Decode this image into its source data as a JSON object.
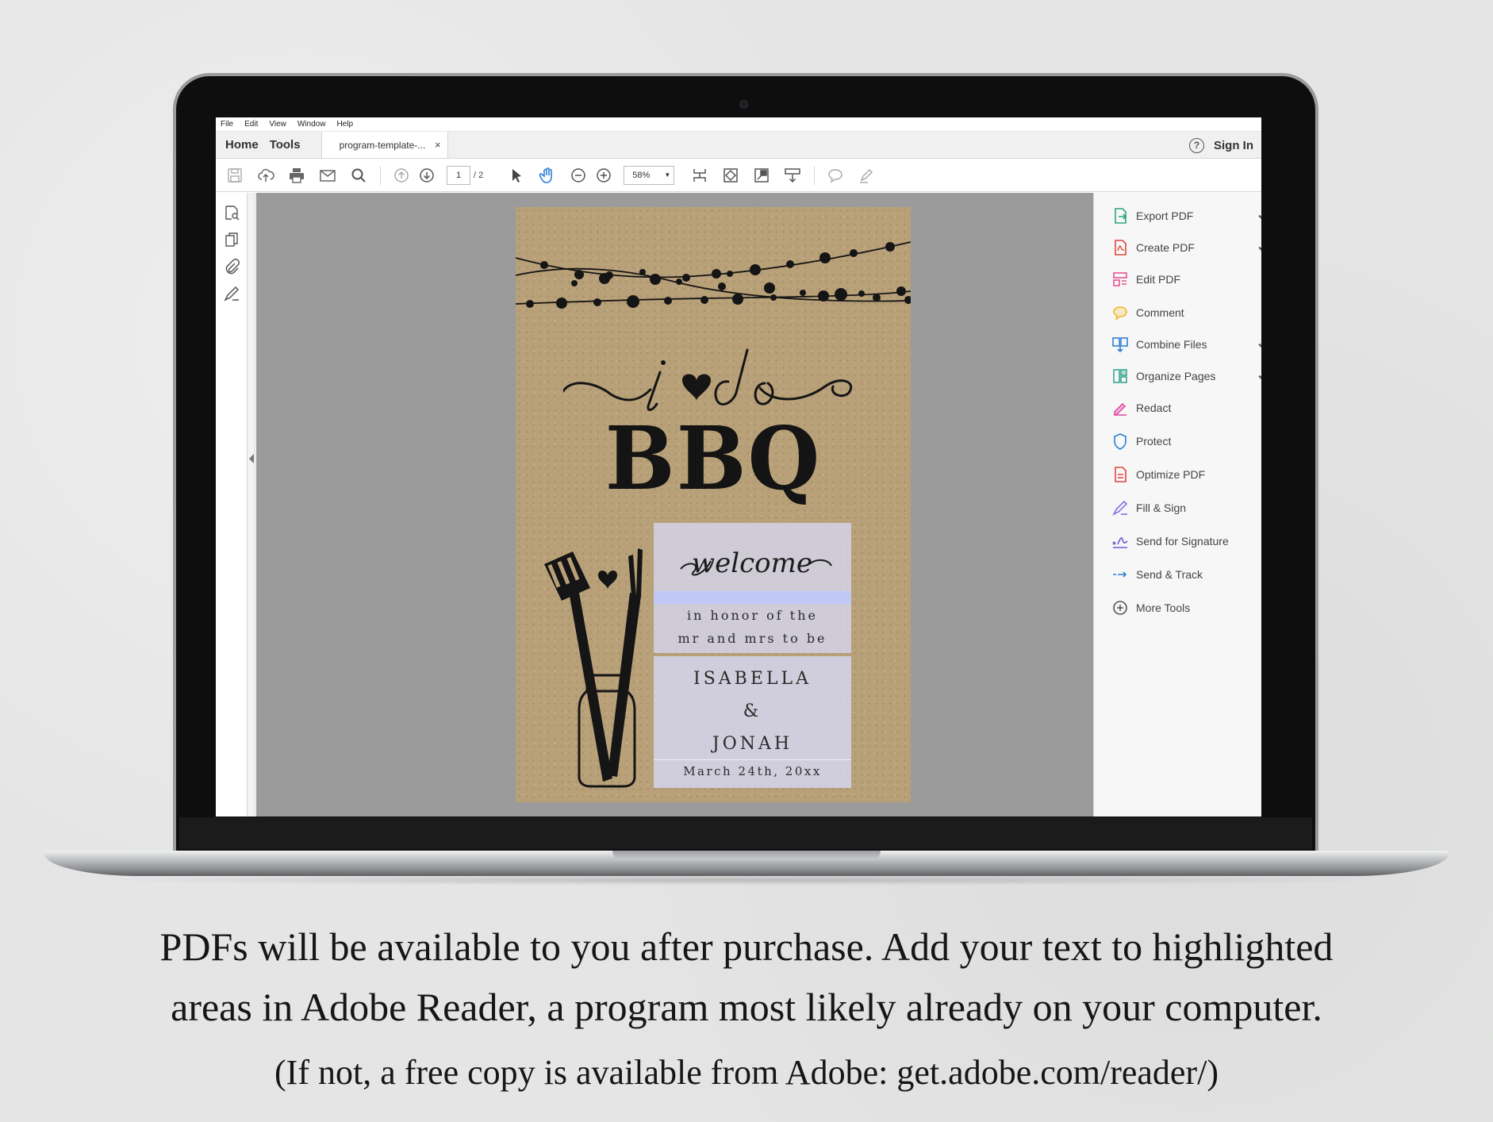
{
  "menubar": {
    "items": [
      "File",
      "Edit",
      "View",
      "Window",
      "Help"
    ]
  },
  "tabs": {
    "home": "Home",
    "tools": "Tools",
    "document": "program-template-...",
    "close": "×",
    "help": "?",
    "sign_in": "Sign In"
  },
  "toolbar": {
    "page_current": "1",
    "page_total": "/ 2",
    "zoom": "58%"
  },
  "document": {
    "script_title": "i ♥ do",
    "title": "BBQ",
    "welcome": "welcome",
    "honor_line1": "in honor of the",
    "honor_line2": "mr and mrs to be",
    "name1": "ISABELLA",
    "ampersand": "&",
    "name2": "JONAH",
    "date": "March 24th, 20xx"
  },
  "tools_pane": {
    "items": [
      {
        "label": "Export PDF",
        "icon": "export-pdf-icon",
        "color": "#2ea67a",
        "expandable": true
      },
      {
        "label": "Create PDF",
        "icon": "create-pdf-icon",
        "color": "#e0473d",
        "expandable": true
      },
      {
        "label": "Edit PDF",
        "icon": "edit-pdf-icon",
        "color": "#e4568f",
        "expandable": false
      },
      {
        "label": "Comment",
        "icon": "comment-icon",
        "color": "#f0b62d",
        "expandable": false
      },
      {
        "label": "Combine Files",
        "icon": "combine-files-icon",
        "color": "#2d7fd6",
        "expandable": true
      },
      {
        "label": "Organize Pages",
        "icon": "organize-pages-icon",
        "color": "#3aa68d",
        "expandable": true
      },
      {
        "label": "Redact",
        "icon": "redact-icon",
        "color": "#e250a5",
        "expandable": false
      },
      {
        "label": "Protect",
        "icon": "protect-icon",
        "color": "#2d7fd6",
        "expandable": false
      },
      {
        "label": "Optimize PDF",
        "icon": "optimize-pdf-icon",
        "color": "#e0473d",
        "expandable": false
      },
      {
        "label": "Fill & Sign",
        "icon": "fill-sign-icon",
        "color": "#8a6fe0",
        "expandable": false
      },
      {
        "label": "Send for Signature",
        "icon": "send-signature-icon",
        "color": "#6a5fd8",
        "expandable": false
      },
      {
        "label": "Send & Track",
        "icon": "send-track-icon",
        "color": "#2d7fd6",
        "expandable": false
      },
      {
        "label": "More Tools",
        "icon": "more-tools-icon",
        "color": "#555555",
        "expandable": false
      }
    ]
  },
  "caption": {
    "line1": "PDFs will be available to you after purchase.  Add your text to highlighted",
    "line2": "areas in Adobe Reader, a program most likely already on your computer.",
    "line3": "(If not, a free copy is available from Adobe: get.adobe.com/reader/)"
  }
}
